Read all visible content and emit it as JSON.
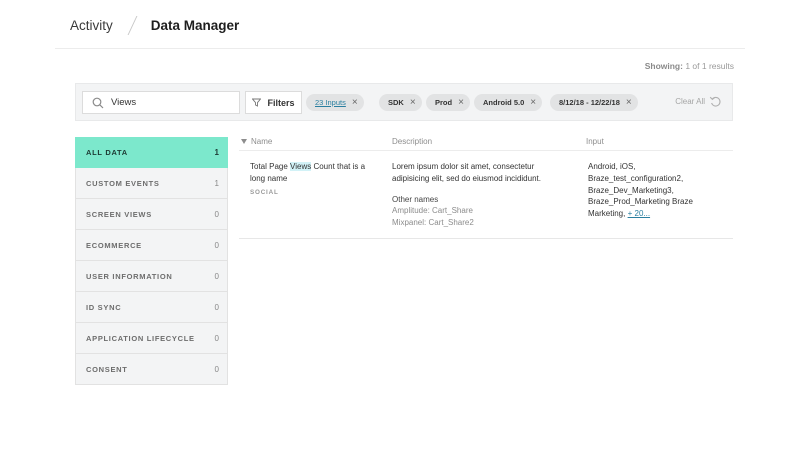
{
  "breadcrumb": {
    "parent": "Activity",
    "current": "Data Manager"
  },
  "results": {
    "label": "Showing:",
    "value": "1 of 1 results"
  },
  "search": {
    "value": "Views",
    "icon": "search-icon"
  },
  "filters_button": {
    "label": "Filters",
    "icon": "filter-icon"
  },
  "chips": [
    {
      "label": "23 Inputs",
      "remove": "×"
    },
    {
      "label": "SDK",
      "remove": "×"
    },
    {
      "label": "Prod",
      "remove": "×"
    },
    {
      "label": "Android 5.0",
      "remove": "×"
    },
    {
      "label": "8/12/18 - 12/22/18",
      "remove": "×"
    }
  ],
  "clear_all": {
    "label": "Clear All",
    "icon": "undo-icon"
  },
  "sidebar": {
    "items": [
      {
        "label": "ALL DATA",
        "count": "1",
        "active": true
      },
      {
        "label": "CUSTOM EVENTS",
        "count": "1"
      },
      {
        "label": "SCREEN VIEWS",
        "count": "0"
      },
      {
        "label": "ECOMMERCE",
        "count": "0"
      },
      {
        "label": "USER INFORMATION",
        "count": "0"
      },
      {
        "label": "ID SYNC",
        "count": "0"
      },
      {
        "label": "APPLICATION LIFECYCLE",
        "count": "0"
      },
      {
        "label": "CONSENT",
        "count": "0"
      }
    ]
  },
  "table": {
    "headers": {
      "name": "Name",
      "description": "Description",
      "input": "Input"
    },
    "rows": [
      {
        "name_before": "Total Page ",
        "name_highlight": "Views",
        "name_after": " Count that is a long name",
        "tag": "SOCIAL",
        "description": "Lorem ipsum dolor sit amet, consectetur adipisicing elit, sed do eiusmod incididunt.",
        "other_names_label": "Other names",
        "other_names": [
          "Amplitude: Cart_Share",
          "Mixpanel: Cart_Share2"
        ],
        "input_lines": [
          "Android, iOS,",
          "Braze_test_configuration2,",
          "Braze_Dev_Marketing3,",
          "Braze_Prod_Marketing Braze"
        ],
        "input_last": "Marketing,",
        "input_more": "+ 20..."
      }
    ]
  },
  "colors": {
    "active_bg": "#7ce8cc",
    "link": "#2a7fa0",
    "highlight": "#d2f2f7"
  }
}
